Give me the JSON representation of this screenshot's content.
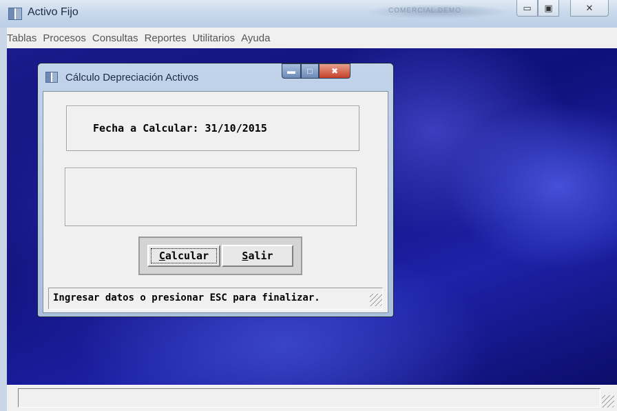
{
  "app": {
    "title": "Activo Fijo",
    "blurred_title_text": "COMERCIAL DEMO",
    "caption_icons": {
      "minimize": "minimize-icon",
      "maximize": "maximize-icon",
      "close": "close-icon"
    }
  },
  "menubar": {
    "items": [
      {
        "label": "Tablas"
      },
      {
        "label": "Procesos"
      },
      {
        "label": "Consultas"
      },
      {
        "label": "Reportes"
      },
      {
        "label": "Utilitarios"
      },
      {
        "label": "Ayuda"
      }
    ]
  },
  "dialog": {
    "title": "Cálculo Depreciación Activos",
    "fecha_label": "Fecha a Calcular: 31/10/2015",
    "buttons": {
      "calcular_first": "C",
      "calcular_rest": "alcular",
      "salir_first": "S",
      "salir_rest": "alir"
    },
    "status_text": "Ingresar datos o presionar ESC para finalizar."
  },
  "colors": {
    "mdi_background": "#15158a",
    "dialog_client": "#f0f0f0",
    "close_button": "#c4402a"
  }
}
